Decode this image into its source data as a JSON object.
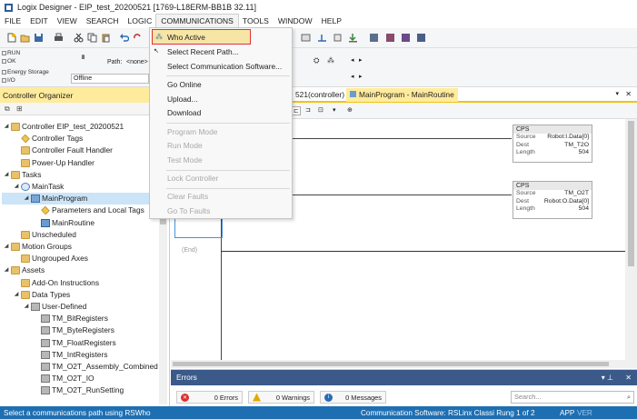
{
  "window": {
    "title": "Logix Designer - EIP_test_20200521 [1769-L18ERM-BB1B 32.11]"
  },
  "menubar": [
    "FILE",
    "EDIT",
    "VIEW",
    "SEARCH",
    "LOGIC",
    "COMMUNICATIONS",
    "TOOLS",
    "WINDOW",
    "HELP"
  ],
  "status": {
    "labels": [
      "RUN",
      "OK",
      "Energy Storage",
      "I/O"
    ],
    "mode": "Offline",
    "path_label": "Path:",
    "path_value": "<none>"
  },
  "comm_menu": {
    "items": [
      {
        "label": "Who Active",
        "enabled": true
      },
      {
        "label": "Select Recent Path...",
        "enabled": true
      },
      {
        "label": "Select Communication Software...",
        "enabled": true
      },
      {
        "label": "Go Online",
        "enabled": true
      },
      {
        "label": "Upload...",
        "enabled": true
      },
      {
        "label": "Download",
        "enabled": true
      },
      {
        "label": "Program Mode",
        "enabled": false
      },
      {
        "label": "Run Mode",
        "enabled": false
      },
      {
        "label": "Test Mode",
        "enabled": false
      },
      {
        "label": "Lock Controller",
        "enabled": false
      },
      {
        "label": "Clear Faults",
        "enabled": false
      },
      {
        "label": "Go To Faults",
        "enabled": false
      }
    ]
  },
  "organizer": {
    "title": "Controller Organizer",
    "tree": [
      {
        "label": "Controller EIP_test_20200521",
        "level": 0
      },
      {
        "label": "Controller Tags",
        "level": 1
      },
      {
        "label": "Controller Fault Handler",
        "level": 1
      },
      {
        "label": "Power-Up Handler",
        "level": 1
      },
      {
        "label": "Tasks",
        "level": 0
      },
      {
        "label": "MainTask",
        "level": 1
      },
      {
        "label": "MainProgram",
        "level": 2,
        "selected": true
      },
      {
        "label": "Parameters and Local Tags",
        "level": 3
      },
      {
        "label": "MainRoutine",
        "level": 3
      },
      {
        "label": "Unscheduled",
        "level": 1
      },
      {
        "label": "Motion Groups",
        "level": 0
      },
      {
        "label": "Ungrouped Axes",
        "level": 1
      },
      {
        "label": "Assets",
        "level": 0
      },
      {
        "label": "Add-On Instructions",
        "level": 1
      },
      {
        "label": "Data Types",
        "level": 1
      },
      {
        "label": "User-Defined",
        "level": 2
      },
      {
        "label": "TM_BitRegisters",
        "level": 3
      },
      {
        "label": "TM_ByteRegisters",
        "level": 3
      },
      {
        "label": "TM_FloatRegisters",
        "level": 3
      },
      {
        "label": "TM_IntRegisters",
        "level": 3
      },
      {
        "label": "TM_O2T_Assembly_Combined",
        "level": 3
      },
      {
        "label": "TM_O2T_IO",
        "level": 3
      },
      {
        "label": "TM_O2T_RunSetting",
        "level": 3
      }
    ]
  },
  "tabs": [
    {
      "label": "521(controller)"
    },
    {
      "label": "MainProgram - MainRoutine",
      "active": true
    }
  ],
  "ladder": {
    "cps": [
      {
        "name": "CPS",
        "source": "Robot:I.Data[0]",
        "dest": "TM_T2O",
        "length": "504"
      },
      {
        "name": "CPS",
        "source": "TM_O2T",
        "dest": "Robot:O.Data[0]",
        "length": "504"
      }
    ],
    "row_labels": {
      "source": "Source",
      "dest": "Dest",
      "length": "Length"
    },
    "end_label": "(End)"
  },
  "errors": {
    "title": "Errors",
    "errors_btn": "0 Errors",
    "warnings_btn": "0 Warnings",
    "messages_btn": "0 Messages",
    "search_placeholder": "Search..."
  },
  "statusbar": {
    "left": "Select a communications path using RSWho",
    "right": "Communication Software: RSLinx Classi Rung 1 of 2",
    "app": "APP",
    "ver": "VER"
  }
}
